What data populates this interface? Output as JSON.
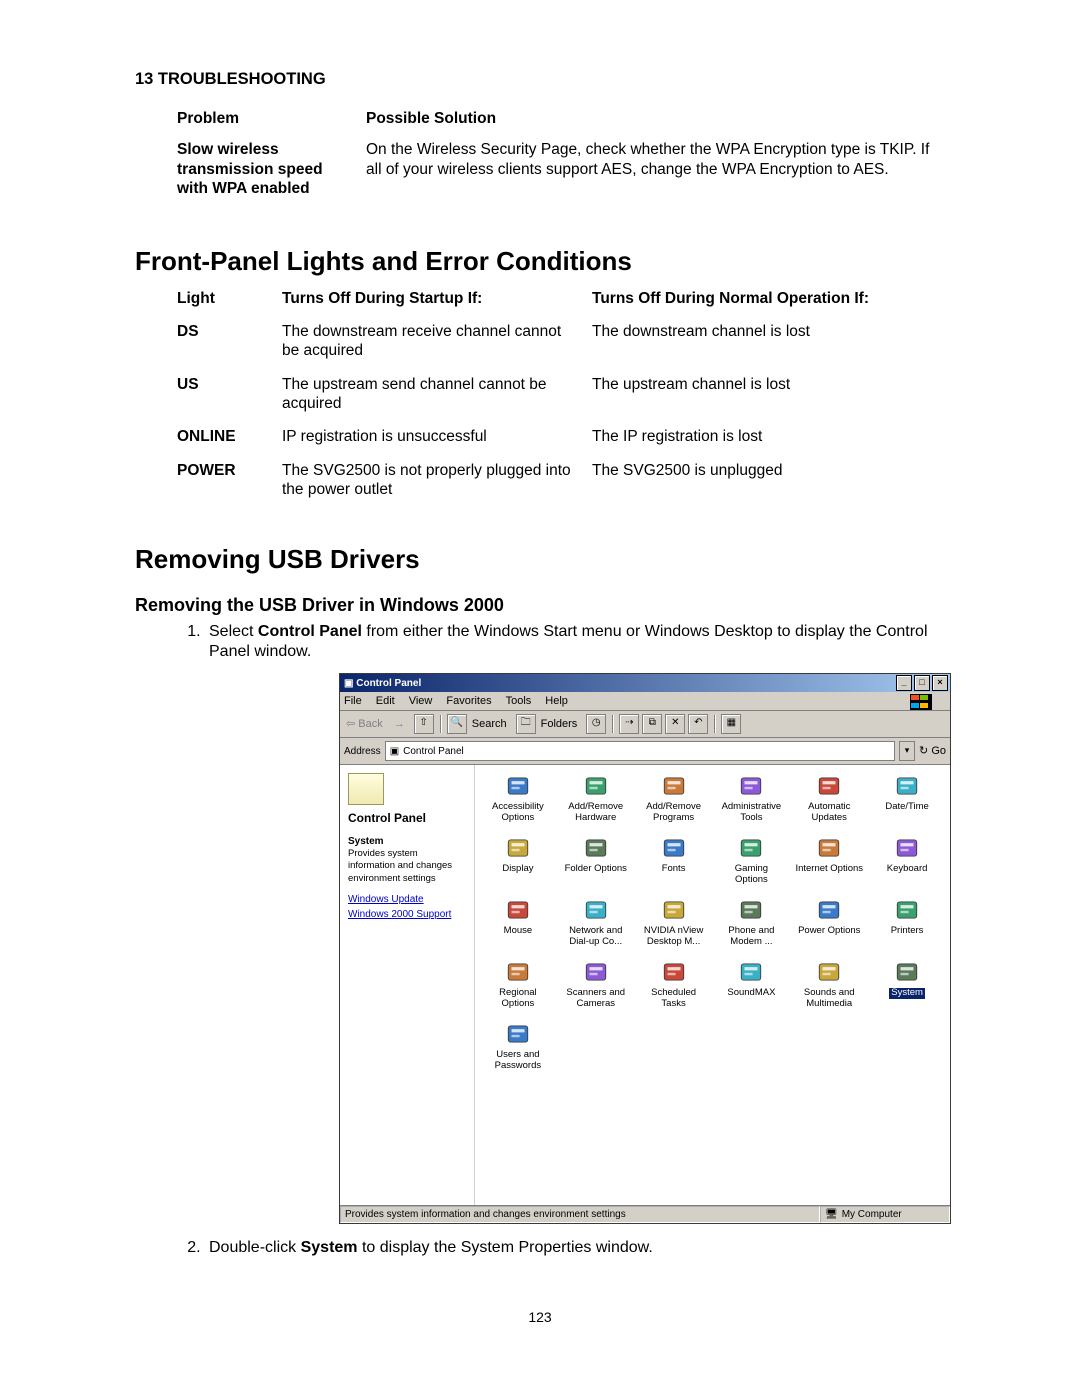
{
  "chapter": "13 TROUBLESHOOTING",
  "problem_table": {
    "h1": "Problem",
    "h2": "Possible Solution",
    "row": {
      "problem": "Slow wireless transmission speed with WPA enabled",
      "solution": "On the Wireless Security Page, check whether the WPA Encryption type is TKIP. If all of your wireless clients support AES, change the WPA Encryption to AES."
    }
  },
  "sec1_title": "Front-Panel Lights and Error Conditions",
  "lights_table": {
    "h1": "Light",
    "h2": "Turns Off During Startup If:",
    "h3": "Turns Off During Normal Operation If:",
    "rows": [
      {
        "light": "DS",
        "startup": "The downstream receive channel cannot be acquired",
        "normal": "The downstream channel is lost"
      },
      {
        "light": "US",
        "startup": "The upstream send channel cannot be acquired",
        "normal": "The upstream channel is lost"
      },
      {
        "light": "ONLINE",
        "startup": "IP registration is unsuccessful",
        "normal": "The IP registration is lost"
      },
      {
        "light": "POWER",
        "startup": "The SVG2500 is not properly plugged into the power outlet",
        "normal": "The SVG2500 is unplugged"
      }
    ]
  },
  "sec2_title": "Removing USB Drivers",
  "subsec_title": "Removing the USB Driver in Windows 2000",
  "step1_a": "Select ",
  "step1_b": "Control Panel",
  "step1_c": " from either the Windows Start menu or Windows Desktop to display the Control Panel window.",
  "step2_a": "Double-click ",
  "step2_b": "System",
  "step2_c": " to display the System Properties window.",
  "cp": {
    "title": "Control Panel",
    "menus": [
      "File",
      "Edit",
      "View",
      "Favorites",
      "Tools",
      "Help"
    ],
    "back": "Back",
    "search": "Search",
    "folders": "Folders",
    "address_label": "Address",
    "address_value": "Control Panel",
    "go": "Go",
    "side_title": "Control Panel",
    "side_head": "System",
    "side_desc": "Provides system information and changes environment settings",
    "side_link1": "Windows Update",
    "side_link2": "Windows 2000 Support",
    "items": [
      "Accessibility Options",
      "Add/Remove Hardware",
      "Add/Remove Programs",
      "Administrative Tools",
      "Automatic Updates",
      "Date/Time",
      "Display",
      "Folder Options",
      "Fonts",
      "Gaming Options",
      "Internet Options",
      "Keyboard",
      "Mouse",
      "Network and Dial-up Co...",
      "NVIDIA nView Desktop M...",
      "Phone and Modem ...",
      "Power Options",
      "Printers",
      "Regional Options",
      "Scanners and Cameras",
      "Scheduled Tasks",
      "SoundMAX",
      "Sounds and Multimedia",
      "System",
      "Users and Passwords"
    ],
    "selected_index": 23,
    "status_left": "Provides system information and changes environment settings",
    "status_right": "My Computer"
  },
  "page_number": "123"
}
